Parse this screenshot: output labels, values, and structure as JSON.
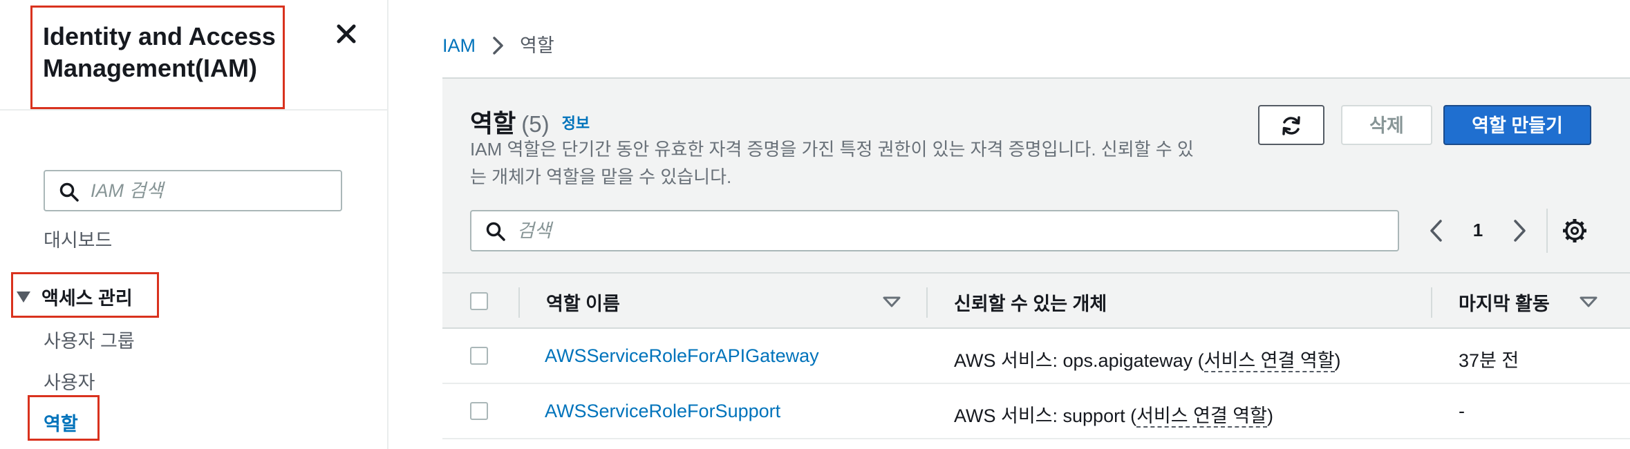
{
  "sidebar": {
    "title_line1": "Identity and Access",
    "title_line2": "Management(IAM)",
    "search_placeholder": "IAM 검색",
    "dashboard": "대시보드",
    "section_access": "액세스 관리",
    "items": {
      "user_groups": "사용자 그룹",
      "users": "사용자",
      "roles": "역할"
    }
  },
  "breadcrumb": {
    "root": "IAM",
    "current": "역할"
  },
  "panel": {
    "title": "역할",
    "count": "(5)",
    "info_link": "정보",
    "description": "IAM 역할은 단기간 동안 유효한 자격 증명을 가진 특정 권한이 있는 자격 증명입니다. 신뢰할 수 있는 개체가 역할을 맡을 수 있습니다.",
    "delete_label": "삭제",
    "create_label": "역할 만들기",
    "search_placeholder": "검색",
    "page_number": "1"
  },
  "table": {
    "columns": {
      "role_name": "역할 이름",
      "trusted_entity": "신뢰할 수 있는 개체",
      "last_activity": "마지막 활동"
    },
    "rows": [
      {
        "role_name": "AWSServiceRoleForAPIGateway",
        "entity_prefix": "AWS 서비스: ops.apigateway (",
        "entity_link": "서비스 연결 역할",
        "entity_suffix": ")",
        "last_activity": "37분 전"
      },
      {
        "role_name": "AWSServiceRoleForSupport",
        "entity_prefix": "AWS 서비스: support (",
        "entity_link": "서비스 연결 역할",
        "entity_suffix": ")",
        "last_activity": "-"
      }
    ]
  },
  "colors": {
    "link": "#0073bb",
    "primary_button": "#1f6fd0",
    "highlight": "#d9321e",
    "header_bg": "#f2f3f3"
  },
  "icons": [
    "close-icon",
    "search-icon",
    "caret-down-icon",
    "chevron-right-icon",
    "refresh-icon",
    "chevron-left-icon",
    "gear-icon",
    "sort-icon"
  ]
}
